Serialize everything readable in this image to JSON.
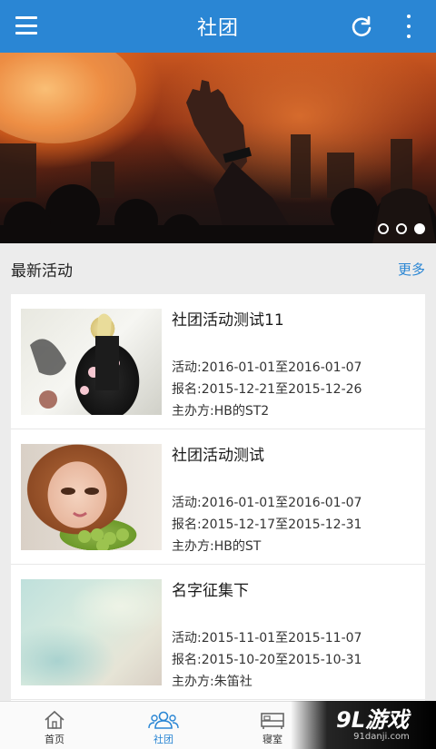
{
  "app": {
    "title": "社团"
  },
  "colors": {
    "primary": "#2a86d4",
    "background": "#ececec",
    "nav_active": "#2a86d4"
  },
  "banner": {
    "slide_count": 3,
    "active_slide": 3
  },
  "section": {
    "title": "最新活动",
    "more_label": "更多"
  },
  "activities": [
    {
      "name": "社团活动测试11",
      "activity": "活动:2016-01-01至2016-01-07",
      "signup": "报名:2015-12-21至2015-12-26",
      "organizer": "主办方:HB的ST2"
    },
    {
      "name": "社团活动测试",
      "activity": "活动:2016-01-01至2016-01-07",
      "signup": "报名:2015-12-17至2015-12-31",
      "organizer": "主办方:HB的ST"
    },
    {
      "name": "名字征集下",
      "activity": "活动:2015-11-01至2015-11-07",
      "signup": "报名:2015-10-20至2015-10-31",
      "organizer": "主办方:朱笛社"
    }
  ],
  "nav": [
    {
      "label": "首页",
      "icon": "home-icon",
      "active": false
    },
    {
      "label": "社团",
      "icon": "club-icon",
      "active": true
    },
    {
      "label": "寝室",
      "icon": "dorm-icon",
      "active": false
    }
  ],
  "watermark": {
    "logo": "9L游戏",
    "url": "91danji.com"
  }
}
